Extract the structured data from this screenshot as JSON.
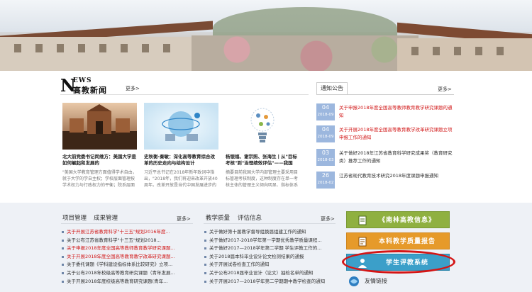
{
  "news": {
    "logo_en": "EWS",
    "logo_initial": "N",
    "logo_cn": "高教新闻",
    "more_label": "更多>",
    "items": [
      {
        "title": "北大前党委书记闵维方：美国大学是如何崛起和发展的",
        "desc": "\"美国大学教育管理方面值得学术自由，就于大学的学自主权；学校层面管理按学术权力与行政权力的平衡；院系层面强调的教授为的管理；组织独立的校董会董事了社会..."
      },
      {
        "title": "史秋衡·秦敏：深化高等教育综合改革的历史走向与结构设计",
        "desc": "习近平总书记在2018年新年致词中指出，\"2018年，我们将迎来改革开放40周年。改革开放是当代中国发展进步的必由之路，是实现中国梦的必由之路。我们要以庆祝..."
      },
      {
        "title": "杨银福、谢宗照、张海生丨从\"目标考核\"到\"治理绩效评估\"——我国大...",
        "desc": "摘要目前我国大学内部管理主要采用目标管理考核制度，这种制度存在单一考核主体的管理主义倾向明显、指标体系内容与校董形表，考核方式求量发展、考核结果与..."
      }
    ]
  },
  "notice": {
    "tab_label": "通知公告",
    "more_label": "更多>",
    "items": [
      {
        "day": "04",
        "ym": "2018-09",
        "text": "关于申报2018年度全国高等教师教育教学研究课题的通知",
        "color": "red"
      },
      {
        "day": "04",
        "ym": "2018-09",
        "text": "关于开展2018年度全国高等教育教学改革研究课题立项申报工作的通知",
        "color": "red"
      },
      {
        "day": "03",
        "ym": "2018-03",
        "text": "关于做好2018年江苏省教育科学研究成果奖（教育研究类）推荐工作的通知",
        "color": "dark"
      },
      {
        "day": "26",
        "ym": "2018-02",
        "text": "江苏省现代教育技术研究2018年度课题申报通知",
        "color": "dark"
      }
    ]
  },
  "projects": {
    "tab1": "项目管理",
    "tab2": "成果管理",
    "more_label": "更多>",
    "items": [
      {
        "text": "关于开展江苏省教育科学\"十三五\"规划2016年度...",
        "color": "red"
      },
      {
        "text": "关于公布江苏省教育科学\"十三五\"规划2018...",
        "color": "dark"
      },
      {
        "text": "关于申报2018年度全国高等教师教育教学研究课题...",
        "color": "red"
      },
      {
        "text": "关于开展2018年度全国高等教育教学改革研究课题...",
        "color": "red"
      },
      {
        "text": "关于委托课题《学科建设指标体系比较研究》立项...",
        "color": "dark"
      },
      {
        "text": "关于公布2018年校级高等教育研究课题（青年发展...",
        "color": "dark"
      },
      {
        "text": "关于开展2018年度校级高等教育研究课题(青年...",
        "color": "dark"
      }
    ]
  },
  "quality": {
    "tab1": "教学质量",
    "tab2": "评估信息",
    "more_label": "更多>",
    "items": [
      {
        "text": "关于做好第十届教学督导组换届组建工作的通知",
        "color": "dark"
      },
      {
        "text": "关于做好2017-2018学年第一学期优秀教学质量课程...",
        "color": "dark"
      },
      {
        "text": "关于做好2017—2018学年第二学期 学生评教工作的...",
        "color": "dark"
      },
      {
        "text": "关于2018届本科毕业设计论文检测结果的通报",
        "color": "dark"
      },
      {
        "text": "关于开展试卷检查工作的通知",
        "color": "dark"
      },
      {
        "text": "关于公布2018届毕业设计（论文）抽检名单的通知",
        "color": "dark"
      },
      {
        "text": "关于开展2017—2018学年第二学期期中教学检查的通知",
        "color": "dark"
      }
    ]
  },
  "right_links": {
    "btn1": "《南林高教信息》",
    "btn2": "本科教学质量报告",
    "btn3": "学生评教系统",
    "friend": "友情链接"
  },
  "colors": {
    "red_text": "#d21a1a",
    "date_box": "#9cb7de",
    "green_btn": "#8fb040",
    "orange_btn": "#e69a2a",
    "blue_btn": "#3b9fc9",
    "highlight_oval": "#d41515"
  }
}
